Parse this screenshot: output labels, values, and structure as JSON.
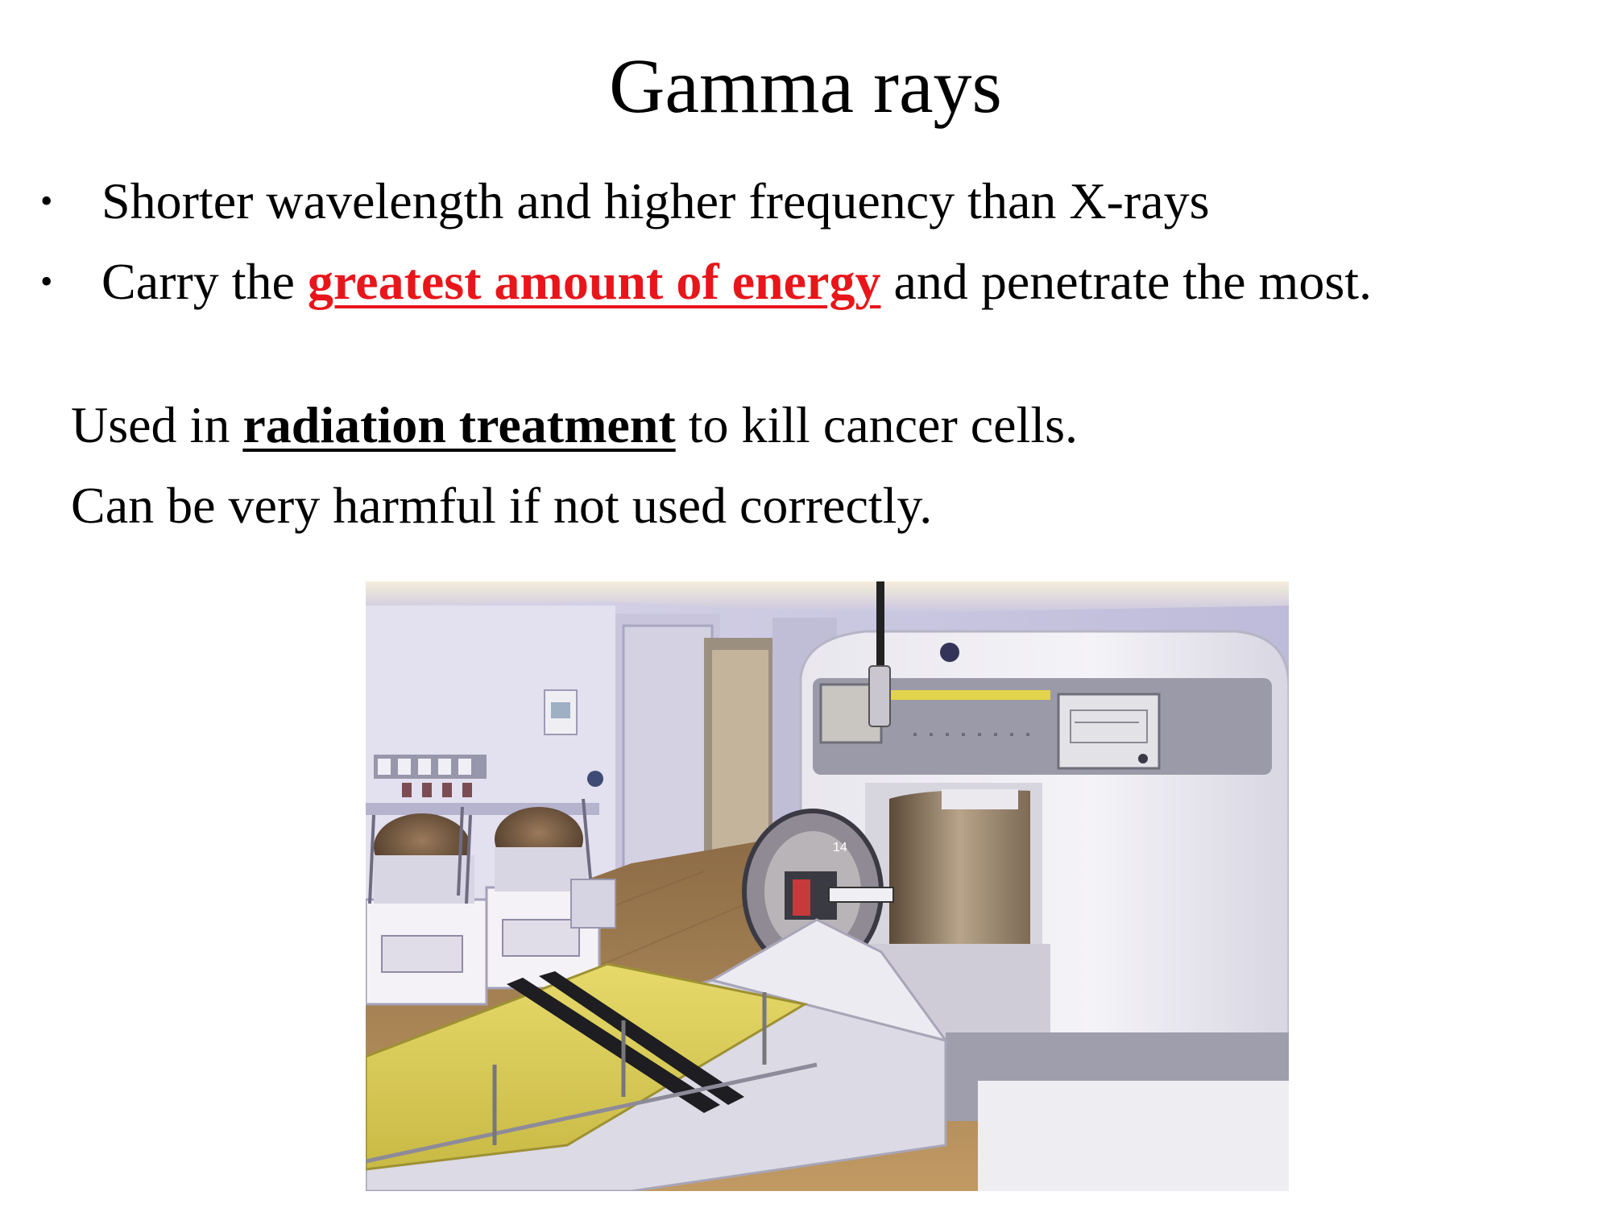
{
  "slide": {
    "title": "Gamma rays",
    "bullets": [
      {
        "text": "Shorter wavelength and higher frequency than X-rays"
      },
      {
        "prefix": "Carry the ",
        "highlight": "greatest amount of energy",
        "suffix": " and penetrate the most."
      }
    ],
    "line1": {
      "prefix": "Used in ",
      "emphasis": "radiation treatment",
      "suffix": " to kill cancer cells."
    },
    "line2": "Can be very harmful if not used correctly.",
    "bullet_glyph": "•",
    "highlight_color": "#e8161b"
  },
  "photo": {
    "subject": "gamma-knife-radiation-treatment-machine",
    "machine_number_label": "14"
  }
}
